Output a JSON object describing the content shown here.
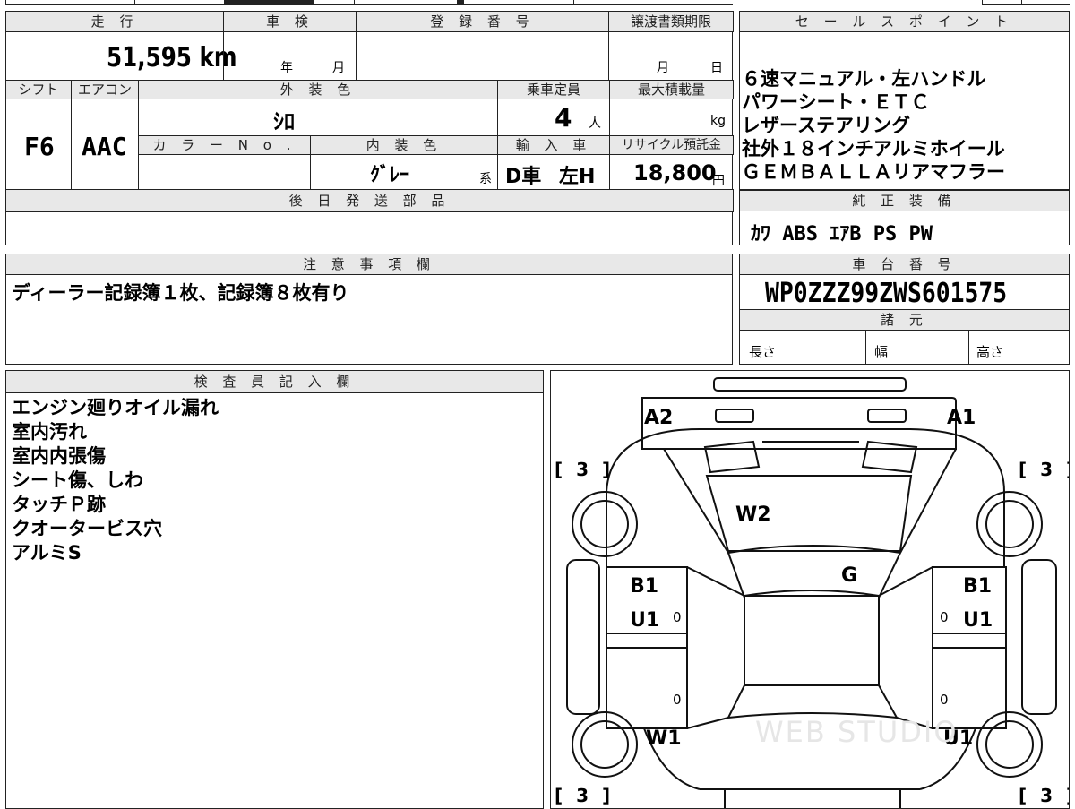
{
  "top_section": {
    "headers": {
      "mileage": "走 行",
      "shaken": "車 検",
      "reg_no": "登 録 番 号",
      "transfer_deadline": "譲渡書類期限"
    },
    "mileage": "51,595",
    "mileage_unit": "km",
    "shaken_year_label": "年",
    "shaken_month_label": "月",
    "deadline_month_label": "月",
    "deadline_day_label": "日",
    "row2_headers": {
      "shift": "シフト",
      "aircon": "エアコン",
      "ext_color": "外 装 色",
      "capacity": "乗車定員",
      "max_load": "最大積載量"
    },
    "shift": "F6",
    "aircon": "AAC",
    "ext_color": "ｼﾛ",
    "capacity": "4",
    "capacity_unit": "人",
    "load_unit": "kg",
    "row3_headers": {
      "color_no": "カ ラ ー N o .",
      "int_color": "内 装 色",
      "import": "輸 入 車",
      "recycle": "リサイクル預託金"
    },
    "int_color": "ｸﾞﾚｰ",
    "int_color_suffix": "系",
    "import_d": "D車",
    "import_handle": "左H",
    "recycle_amount": "18,800",
    "recycle_unit": "円",
    "later_parts_header": "後 日 発 送 部 品"
  },
  "sales_points": {
    "header": "セ ー ル ス ポ イ ン ト",
    "lines": [
      "６速マニュアル・左ハンドル",
      "パワーシート・ＥＴＣ",
      "レザーステアリング",
      "社外１８インチアルミホイール",
      "ＧＥＭＢＡＬＬＡリアマフラー"
    ]
  },
  "equipment": {
    "header": "純 正 装 備",
    "value": "ｶﾜ ABS ｴｱB PS PW"
  },
  "notes": {
    "header": "注 意 事 項 欄",
    "value": "ディーラー記録簿１枚、記録簿８枚有り"
  },
  "chassis": {
    "header": "車 台 番 号",
    "value": "WP0ZZZ99ZWS601575"
  },
  "specs": {
    "header": "諸 元",
    "length": "長さ",
    "width": "幅",
    "height": "高さ"
  },
  "inspector": {
    "header": "検 査 員 記 入 欄",
    "lines": [
      "エンジン廻りオイル漏れ",
      "室内汚れ",
      "室内内張傷",
      "シート傷、しわ",
      "タッチＰ跡",
      "クオータービス穴",
      "アルミS"
    ]
  },
  "diagram": {
    "labels": {
      "a2": "A2",
      "a1": "A1",
      "w2": "W2",
      "g": "G",
      "b1_left": "B1",
      "u1_left": "U1",
      "b1_right": "B1",
      "u1_right": "U1",
      "w1": "W1",
      "u1_rear_right": "U1"
    },
    "tire_brackets": {
      "tl": "[ 3 ]",
      "tr": "[ 3 ]",
      "bl": "[ 3 ]",
      "br": "[ 3 ]"
    },
    "zeros": [
      "0",
      "0",
      "0",
      "0"
    ],
    "watermark": "WEB STUDIO"
  }
}
